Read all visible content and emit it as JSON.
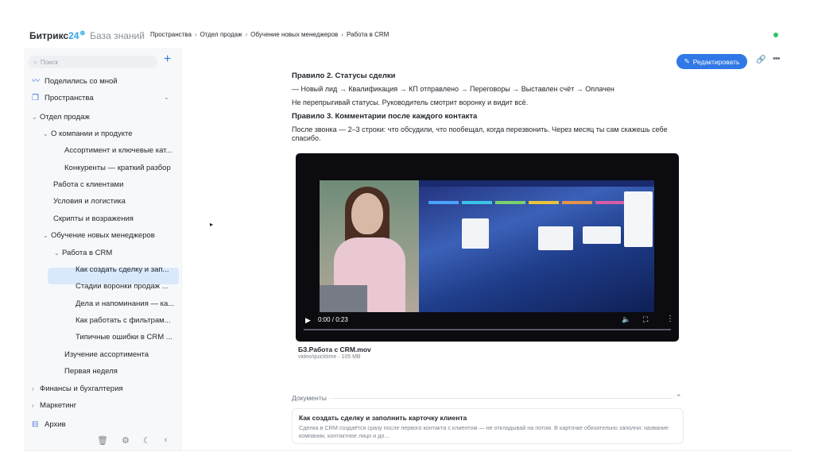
{
  "topbar": {
    "logo_name": "Битрикс",
    "logo_num": "24",
    "logo_kb": "База знаний",
    "breadcrumbs": [
      "Пространства",
      "Отдел продаж",
      "Обучение новых менеджеров",
      "Работа в CRM"
    ]
  },
  "sidebar": {
    "search_placeholder": "Поиск",
    "items": [
      {
        "label": "Поделились со мной"
      },
      {
        "label": "Пространства"
      },
      {
        "label": "Отдел продаж"
      },
      {
        "label": "О компании и продукте"
      },
      {
        "label": "Ассортимент и ключевые кат..."
      },
      {
        "label": "Конкуренты — краткий разбор"
      },
      {
        "label": "Работа с клиентами"
      },
      {
        "label": "Условия и логистика"
      },
      {
        "label": "Скрипты и возражения"
      },
      {
        "label": "Обучение новых менеджеров"
      },
      {
        "label": "Работа в CRM"
      },
      {
        "label": "Как создать сделку и зап..."
      },
      {
        "label": "Стадии воронки продаж ..."
      },
      {
        "label": "Дела и напоминания — ка..."
      },
      {
        "label": "Как работать с фильтрам..."
      },
      {
        "label": "Типичные ошибки в CRM ..."
      },
      {
        "label": "Изучение ассортимента"
      },
      {
        "label": "Первая неделя"
      },
      {
        "label": "Финансы и бухгалтерия"
      },
      {
        "label": "Маркетинг"
      },
      {
        "label": "Архив"
      }
    ]
  },
  "toolbar": {
    "edit_label": "Редактировать"
  },
  "article": {
    "rule2_title": "Правило 2. Статусы сделки",
    "rule2_flow": "— Новый лид → Квалификация → КП отправлено → Переговоры → Выставлен счёт → Оплачен",
    "rule2_note": "Не перепрыгивай статусы. Руководитель смотрит воронку и видит всё.",
    "rule3_title": "Правило 3. Комментарии после каждого контакта",
    "rule3_text": "После звонка — 2–3 строки: что обсудили, что пообещал, когда перезвонить. Через месяц ты сам скажешь себе спасибо."
  },
  "video": {
    "time": "0:00 / 0:23",
    "progress": 0.0,
    "file_name": "БЗ.Работа с CRM.mov",
    "file_meta": "video/quicktime · 105 MB"
  },
  "documents": {
    "heading": "Документы",
    "card_title": "Как создать сделку и заполнить карточку клиента",
    "card_desc": "Сделка в CRM создаётся сразу после первого контакта с клиентом — не откладывай на потом. В карточке обязательно заполни: название компании, контактное лицо и до..."
  },
  "colors": {
    "accent": "#2f78e6",
    "active_item": "#d9e9fb",
    "status_dot": "#2fc26b"
  }
}
